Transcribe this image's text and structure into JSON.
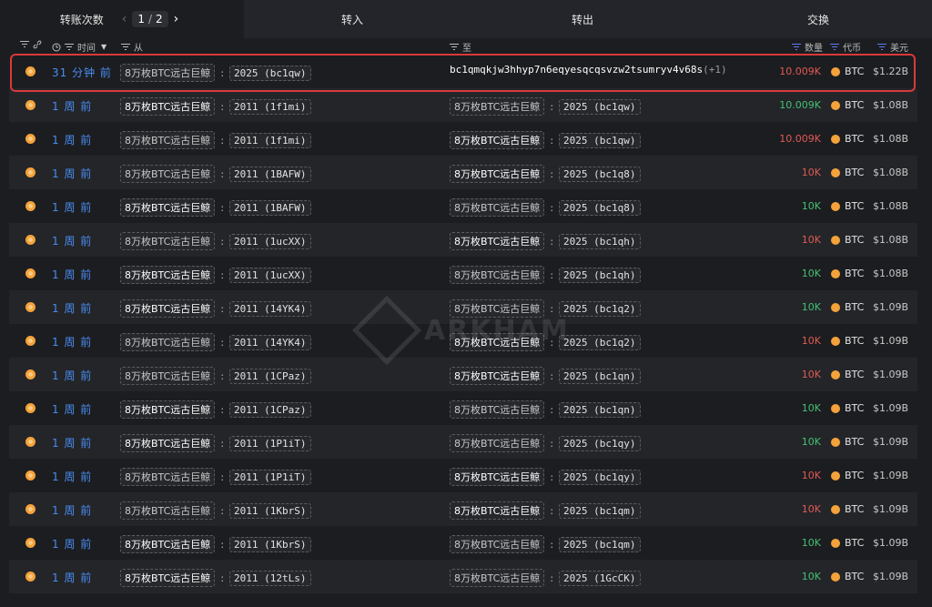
{
  "tabs": {
    "transfers_label": "转账次数",
    "page_current": "1",
    "page_total": "2",
    "inflow_label": "转入",
    "outflow_label": "转出",
    "swap_label": "交换"
  },
  "header": {
    "time": "时间",
    "from": "从",
    "to": "至",
    "amount": "数量",
    "token": "代币",
    "usd": "美元"
  },
  "rows": [
    {
      "time": "31 分钟 前",
      "from_entity": "8万枚BTC远古巨鲸",
      "from_addr": "2025 (bc1qw)",
      "to_address": "bc1qmqkjw3hhyp7n6eqyesqcqsvzw2tsumryv4v68s",
      "to_extra": "(+1)",
      "amount": "10.009K",
      "amount_color": "red",
      "token": "BTC",
      "usd": "$1.22B"
    },
    {
      "time": "1 周 前",
      "from_entity": "8万枚BTC远古巨鲸",
      "from_addr": "2011 (1f1mi)",
      "to_entity": "8万枚BTC远古巨鲸",
      "to_addr": "2025 (bc1qw)",
      "amount": "10.009K",
      "amount_color": "green",
      "token": "BTC",
      "usd": "$1.08B"
    },
    {
      "time": "1 周 前",
      "from_entity": "8万枚BTC远古巨鲸",
      "from_addr": "2011 (1f1mi)",
      "to_entity": "8万枚BTC远古巨鲸",
      "to_addr": "2025 (bc1qw)",
      "amount": "10.009K",
      "amount_color": "red",
      "token": "BTC",
      "usd": "$1.08B"
    },
    {
      "time": "1 周 前",
      "from_entity": "8万枚BTC远古巨鲸",
      "from_addr": "2011 (1BAFW)",
      "to_entity": "8万枚BTC远古巨鲸",
      "to_addr": "2025 (bc1q8)",
      "amount": "10K",
      "amount_color": "red",
      "token": "BTC",
      "usd": "$1.08B"
    },
    {
      "time": "1 周 前",
      "from_entity": "8万枚BTC远古巨鲸",
      "from_addr": "2011 (1BAFW)",
      "to_entity": "8万枚BTC远古巨鲸",
      "to_addr": "2025 (bc1q8)",
      "amount": "10K",
      "amount_color": "green",
      "token": "BTC",
      "usd": "$1.08B"
    },
    {
      "time": "1 周 前",
      "from_entity": "8万枚BTC远古巨鲸",
      "from_addr": "2011 (1ucXX)",
      "to_entity": "8万枚BTC远古巨鲸",
      "to_addr": "2025 (bc1qh)",
      "amount": "10K",
      "amount_color": "red",
      "token": "BTC",
      "usd": "$1.08B"
    },
    {
      "time": "1 周 前",
      "from_entity": "8万枚BTC远古巨鲸",
      "from_addr": "2011 (1ucXX)",
      "to_entity": "8万枚BTC远古巨鲸",
      "to_addr": "2025 (bc1qh)",
      "amount": "10K",
      "amount_color": "green",
      "token": "BTC",
      "usd": "$1.08B"
    },
    {
      "time": "1 周 前",
      "from_entity": "8万枚BTC远古巨鲸",
      "from_addr": "2011 (14YK4)",
      "to_entity": "8万枚BTC远古巨鲸",
      "to_addr": "2025 (bc1q2)",
      "amount": "10K",
      "amount_color": "green",
      "token": "BTC",
      "usd": "$1.09B"
    },
    {
      "time": "1 周 前",
      "from_entity": "8万枚BTC远古巨鲸",
      "from_addr": "2011 (14YK4)",
      "to_entity": "8万枚BTC远古巨鲸",
      "to_addr": "2025 (bc1q2)",
      "amount": "10K",
      "amount_color": "red",
      "token": "BTC",
      "usd": "$1.09B"
    },
    {
      "time": "1 周 前",
      "from_entity": "8万枚BTC远古巨鲸",
      "from_addr": "2011 (1CPaz)",
      "to_entity": "8万枚BTC远古巨鲸",
      "to_addr": "2025 (bc1qn)",
      "amount": "10K",
      "amount_color": "red",
      "token": "BTC",
      "usd": "$1.09B"
    },
    {
      "time": "1 周 前",
      "from_entity": "8万枚BTC远古巨鲸",
      "from_addr": "2011 (1CPaz)",
      "to_entity": "8万枚BTC远古巨鲸",
      "to_addr": "2025 (bc1qn)",
      "amount": "10K",
      "amount_color": "green",
      "token": "BTC",
      "usd": "$1.09B"
    },
    {
      "time": "1 周 前",
      "from_entity": "8万枚BTC远古巨鲸",
      "from_addr": "2011 (1P1iT)",
      "to_entity": "8万枚BTC远古巨鲸",
      "to_addr": "2025 (bc1qy)",
      "amount": "10K",
      "amount_color": "green",
      "token": "BTC",
      "usd": "$1.09B"
    },
    {
      "time": "1 周 前",
      "from_entity": "8万枚BTC远古巨鲸",
      "from_addr": "2011 (1P1iT)",
      "to_entity": "8万枚BTC远古巨鲸",
      "to_addr": "2025 (bc1qy)",
      "amount": "10K",
      "amount_color": "red",
      "token": "BTC",
      "usd": "$1.09B"
    },
    {
      "time": "1 周 前",
      "from_entity": "8万枚BTC远古巨鲸",
      "from_addr": "2011 (1KbrS)",
      "to_entity": "8万枚BTC远古巨鲸",
      "to_addr": "2025 (bc1qm)",
      "amount": "10K",
      "amount_color": "red",
      "token": "BTC",
      "usd": "$1.09B"
    },
    {
      "time": "1 周 前",
      "from_entity": "8万枚BTC远古巨鲸",
      "from_addr": "2011 (1KbrS)",
      "to_entity": "8万枚BTC远古巨鲸",
      "to_addr": "2025 (bc1qm)",
      "amount": "10K",
      "amount_color": "green",
      "token": "BTC",
      "usd": "$1.09B"
    },
    {
      "time": "1 周 前",
      "from_entity": "8万枚BTC远古巨鲸",
      "from_addr": "2011 (12tLs)",
      "to_entity": "8万枚BTC远古巨鲸",
      "to_addr": "2025 (1GcCK)",
      "amount": "10K",
      "amount_color": "green",
      "token": "BTC",
      "usd": "$1.09B"
    }
  ],
  "colors": {
    "red": "#e05a55",
    "green": "#45c074",
    "link": "#4a8cf0",
    "highlight": "#d9393a",
    "btc": "#f4a23a"
  },
  "watermark": "ARKHAM"
}
